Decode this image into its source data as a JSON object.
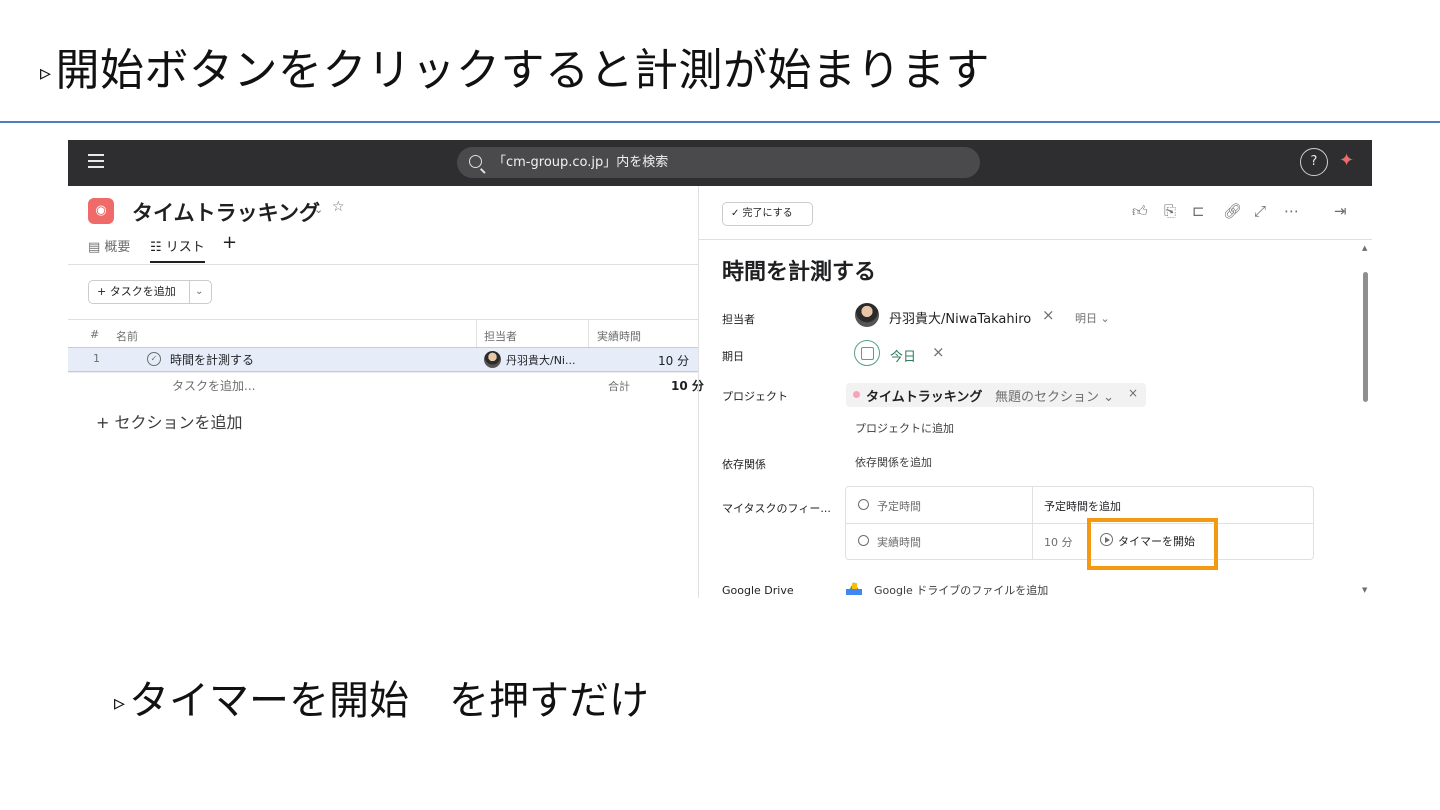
{
  "slide": {
    "title": "開始ボタンをクリックすると計測が始まります",
    "title_marker": "▹",
    "caption": "タイマーを開始　を押すだけ",
    "caption_marker": "▹"
  },
  "topbar": {
    "search_placeholder": "「cm-group.co.jp」内を検索",
    "help_label": "?"
  },
  "project": {
    "title": "タイムトラッキング",
    "tabs": [
      {
        "label": "概要"
      },
      {
        "label": "リスト"
      },
      {
        "label": "+"
      }
    ]
  },
  "list": {
    "add_task_button": "+ タスクを追加",
    "columns": {
      "num": "#",
      "name": "名前",
      "assignee": "担当者",
      "actual_time": "実績時間"
    },
    "rows": [
      {
        "num": "1",
        "name": "時間を計測する",
        "assignee": "丹羽貴大/Ni...",
        "actual_time": "10 分"
      }
    ],
    "add_task_inline": "タスクを追加...",
    "total_label": "合計",
    "total_value": "10 分",
    "add_section": "+ セクションを追加"
  },
  "detail": {
    "complete_button": "✓ 完了にする",
    "task_title": "時間を計測する",
    "fields": {
      "assignee_label": "担当者",
      "assignee_value": "丹羽貴大/NiwaTakahiro",
      "assignee_remove": "×",
      "assignee_due": "明日 ⌄",
      "due_label": "期日",
      "due_value": "今日",
      "due_remove": "×",
      "project_label": "プロジェクト",
      "project_value": "タイムトラッキング",
      "project_section": "無題のセクション ⌄",
      "project_remove": "×",
      "add_to_project": "プロジェクトに追加",
      "dependency_label": "依存関係",
      "dependency_add": "依存関係を追加",
      "my_task_label": "マイタスクのフィー...",
      "planned_time_label": "予定時間",
      "planned_time_add": "予定時間を追加",
      "actual_time_label": "実績時間",
      "actual_time_value": "10 分",
      "start_timer": "タイマーを開始",
      "drive_label": "Google Drive",
      "drive_add": "Google ドライブのファイルを追加"
    }
  },
  "colors": {
    "accent_orange": "#f39a12",
    "topbar": "#2e2e30",
    "row_selected": "#e6edf9",
    "project_icon": "#f06a6a",
    "rule_blue": "#4a7fc1"
  }
}
